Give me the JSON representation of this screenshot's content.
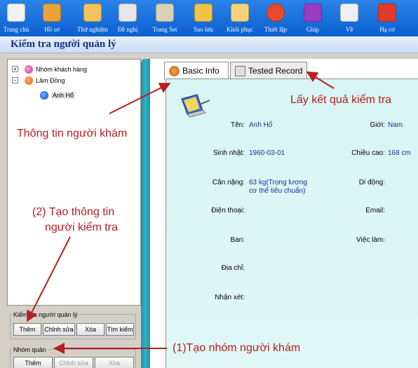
{
  "toolbar": {
    "items": [
      {
        "label": "Trang chủ",
        "icon": "home-icon"
      },
      {
        "label": "Hồ sơ",
        "icon": "users-icon"
      },
      {
        "label": "Thử nghiệm",
        "icon": "hand-icon"
      },
      {
        "label": "Đề nghị",
        "icon": "clipboard-icon"
      },
      {
        "label": "Trang Set",
        "icon": "settings-page-icon"
      },
      {
        "label": "Sao lưu",
        "icon": "backup-icon"
      },
      {
        "label": "Khôi phục",
        "icon": "restore-icon"
      },
      {
        "label": "Thiết lập",
        "icon": "gears-icon"
      },
      {
        "label": "Giúp",
        "icon": "help-book-icon"
      },
      {
        "label": "Về",
        "icon": "about-icon"
      },
      {
        "label": "Hạ cơ",
        "icon": "power-icon"
      }
    ]
  },
  "title": "Kiểm tra người quản lý",
  "tree": {
    "root": "Nhóm khách hàng",
    "group": "Lâm Đồng",
    "person": "Anh Hổ"
  },
  "managers_group": {
    "title": "Kiểm tra người quản lý",
    "buttons": [
      "Thêm",
      "Chỉnh sửa",
      "Xóa",
      "Tìm kiếm"
    ]
  },
  "groups_group": {
    "title": "Nhóm quản",
    "buttons": [
      "Thêm",
      "Chỉnh sửa",
      "Xóa"
    ]
  },
  "tabs": {
    "basic": "Basic Info",
    "tested": "Tested Record"
  },
  "info": {
    "name_label": "Tên:",
    "name_value": "Anh Hổ",
    "gender_label": "Giới:",
    "gender_value": "Nam",
    "birth_label": "Sinh nhật:",
    "birth_value": "1960-03-01",
    "height_label": "Chiều cao:",
    "height_value": "168 cm",
    "weight_label": "Cân nặng:",
    "weight_value_1": "63 kg(Trọng lượng",
    "weight_value_2": "cơ thể tiêu chuẩn)",
    "mobile_label": "Di động:",
    "phone_label": "Điện thoại:",
    "email_label": "Email:",
    "ban_label": "Ban:",
    "job_label": "Việc làm:",
    "address_label": "Địa chỉ:",
    "remarks_label": "Nhận xét:"
  },
  "annotations": {
    "results": "Lấy kết quả kiểm tra",
    "patient_info": "Thông tin người khám",
    "create_tester_1": "(2) Tạo thông tin",
    "create_tester_2": "người kiểm tra",
    "create_group": "(1)Tạo nhóm người khám"
  },
  "colors": {
    "toolbar": "#1a6fe0",
    "accent_red": "#b42020",
    "content_bg": "#d8f5f3",
    "title_text": "#1a2f86"
  }
}
